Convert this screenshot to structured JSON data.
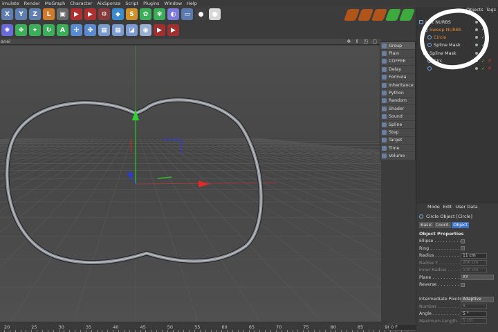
{
  "menu": [
    "imulate",
    "Render",
    "MoGraph",
    "Character",
    "AixSponza",
    "Script",
    "Plugins",
    "Window",
    "Help"
  ],
  "toolbar_row1": [
    {
      "name": "x-axis-icon",
      "glyph": "X",
      "color": "#5f7fb0"
    },
    {
      "name": "y-axis-icon",
      "glyph": "Y",
      "color": "#5f7fb0"
    },
    {
      "name": "z-axis-icon",
      "glyph": "Z",
      "color": "#5f7fb0"
    },
    {
      "name": "coordinate-system-icon",
      "glyph": "L",
      "color": "#d27a2c"
    },
    {
      "name": "render-region-icon",
      "glyph": "▣",
      "color": "#6a6a6a"
    },
    {
      "name": "render-view-icon",
      "glyph": "▶",
      "color": "#b03030"
    },
    {
      "name": "render-picture-viewer-icon",
      "glyph": "▶",
      "color": "#b03030"
    },
    {
      "name": "edit-render-settings-icon",
      "glyph": "⚙",
      "color": "#8a3a3a"
    },
    {
      "name": "cube-icon",
      "glyph": "◆",
      "color": "#3a8ad0"
    },
    {
      "name": "spline-pen-icon",
      "glyph": "S",
      "color": "#d0902a"
    },
    {
      "name": "nurbs-icon",
      "glyph": "✿",
      "color": "#3cae5a"
    },
    {
      "name": "array-icon",
      "glyph": "✾",
      "color": "#3cae5a"
    },
    {
      "name": "deformer-icon",
      "glyph": "◐",
      "color": "#7a7ad8"
    },
    {
      "name": "floor-icon",
      "glyph": "▭",
      "color": "#5a7ab0"
    },
    {
      "name": "camera-icon",
      "glyph": "●",
      "color": "#404040"
    },
    {
      "name": "light-icon",
      "glyph": "●",
      "color": "#d8d8d8"
    }
  ],
  "toolbar_row2": [
    {
      "name": "mograph-cloner-icon",
      "glyph": "✺",
      "color": "#6a6ad8"
    },
    {
      "name": "move-icon",
      "glyph": "✥",
      "color": "#3cae5a"
    },
    {
      "name": "scale-icon",
      "glyph": "✦",
      "color": "#3cae5a"
    },
    {
      "name": "rotate-icon",
      "glyph": "↻",
      "color": "#3cae5a"
    },
    {
      "name": "selection-icon",
      "glyph": "A",
      "color": "#3cae5a"
    },
    {
      "name": "live-selection-icon",
      "glyph": "✣",
      "color": "#5a8ad0"
    },
    {
      "name": "model-mode-icon",
      "glyph": "✤",
      "color": "#5a8ad0"
    },
    {
      "name": "texture-mode-icon",
      "glyph": "▦",
      "color": "#7a9ad0"
    },
    {
      "name": "points-mode-icon",
      "glyph": "▦",
      "color": "#7a9ad0"
    },
    {
      "name": "edges-mode-icon",
      "glyph": "◪",
      "color": "#7a9ad0"
    },
    {
      "name": "polygons-mode-icon",
      "glyph": "◉",
      "color": "#9ab0d0"
    },
    {
      "name": "animation-mode-icon",
      "glyph": "▶",
      "color": "#a03030"
    },
    {
      "name": "render-active-view-icon",
      "glyph": "▶",
      "color": "#a03030"
    }
  ],
  "toolbar_right": [
    {
      "name": "record-keyframe-icon",
      "color": "#b0541a"
    },
    {
      "name": "autokey-icon",
      "color": "#b0541a"
    },
    {
      "name": "keyframe-selection-icon",
      "color": "#b0541a"
    },
    {
      "name": "play-forward-icon",
      "color": "#3caa3c"
    },
    {
      "name": "timeline-icon",
      "color": "#3caa3c"
    }
  ],
  "viewport": {
    "label": "anel",
    "controls": "✥ ⇕ ◳ ▢"
  },
  "timeline": {
    "ticks": [
      "20",
      "25",
      "30",
      "35",
      "40",
      "45",
      "50",
      "55",
      "60",
      "65",
      "70",
      "75",
      "80",
      "85",
      "90"
    ],
    "frame": "0 F"
  },
  "tag_menu": [
    "Group",
    "Plain",
    "COFFEE",
    "Delay",
    "Formula",
    "Inheritance",
    "Python",
    "Random",
    "Shader",
    "Sound",
    "Spline",
    "Step",
    "Target",
    "Time",
    "Volume"
  ],
  "objects": {
    "tabs": [
      "Objects",
      "Tags"
    ],
    "rows": [
      {
        "name": "Loft NURBS",
        "color": "#e0e0e0",
        "indent": 0
      },
      {
        "name": "Sweep NURBS",
        "color": "#e08a3a",
        "indent": 1
      },
      {
        "name": "Circle",
        "color": "#e08a3a",
        "indent": 2
      },
      {
        "name": "Spline Mask",
        "color": "#e0e0e0",
        "indent": 2
      },
      {
        "name": "Spline Mask",
        "color": "#e0e0e0",
        "indent": 1
      },
      {
        "name": "Circ",
        "color": "#e0e0e0",
        "indent": 2
      },
      {
        "name": "",
        "color": "#e0e0e0",
        "indent": 2
      }
    ]
  },
  "attributes": {
    "menu": [
      "Mode",
      "Edit",
      "User Data"
    ],
    "title": "Circle Object [Circle]",
    "tabs": [
      "Basic",
      "Coord.",
      "Object"
    ],
    "section": "Object Properties",
    "props": [
      {
        "label": "Ellipse . . . . . . . . . . .",
        "type": "check"
      },
      {
        "label": "Ring . . . . . . . . . . . . .",
        "type": "check"
      },
      {
        "label": "Radius . . . . . . . . . . .",
        "type": "value",
        "value": "11 cm"
      },
      {
        "label": "Radius Y . . . . . . . . .",
        "type": "value",
        "value": "200 cm",
        "dim": true
      },
      {
        "label": "Inner Radius . . . . . . .",
        "type": "value",
        "value": "100 cm",
        "dim": true
      },
      {
        "label": "Plane . . . . . . . . . . . .",
        "type": "select",
        "value": "XY"
      },
      {
        "label": "Reverse . . . . . . . . . .",
        "type": "check"
      },
      {
        "label": "",
        "type": "gap"
      },
      {
        "label": "Intermediate Points",
        "type": "select",
        "value": "Adaptive"
      },
      {
        "label": "Number . . . . . . . . . . .",
        "type": "value",
        "value": "8",
        "dim": true
      },
      {
        "label": "Angle . . . . . . . . . . . .",
        "type": "value",
        "value": "5 °"
      },
      {
        "label": "Maximum Length . . .",
        "type": "value",
        "value": "5 cm",
        "dim": true
      }
    ]
  }
}
